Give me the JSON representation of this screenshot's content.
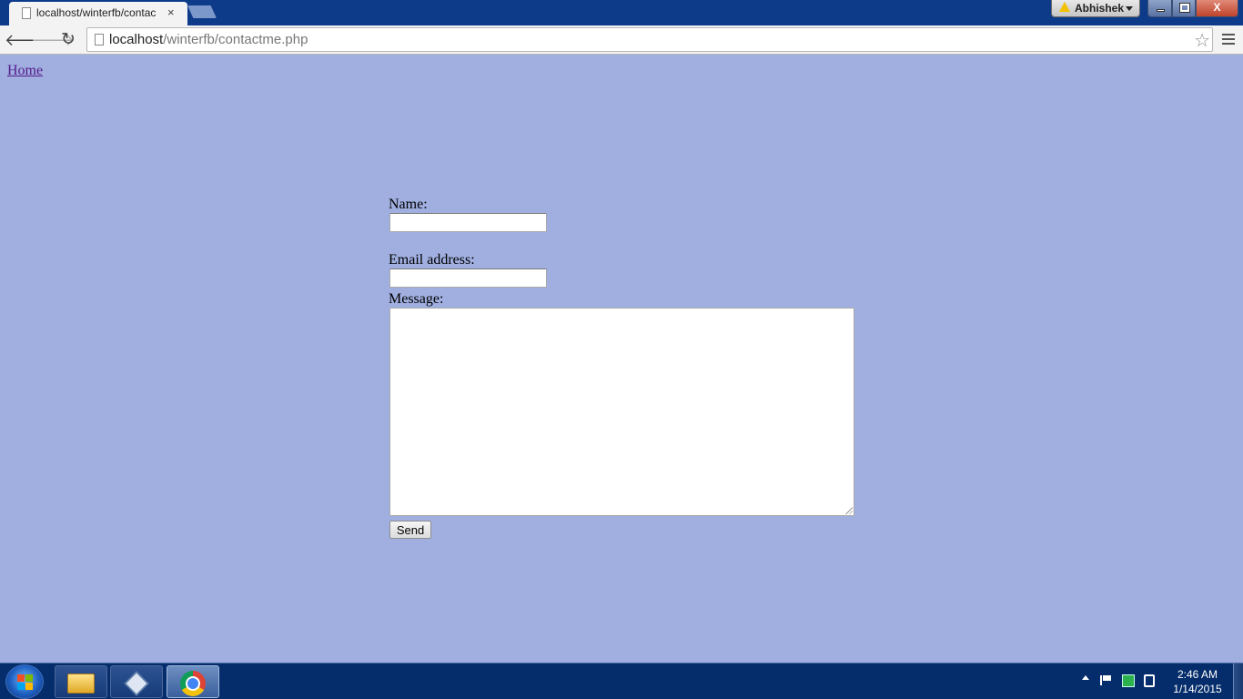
{
  "browser": {
    "tab_title": "localhost/winterfb/contac",
    "tab_close": "×",
    "profile_name": "Abhishek",
    "url_host": "localhost",
    "url_path": "/winterfb/contactme.php",
    "close_glyph": "X"
  },
  "page": {
    "home_link": "Home",
    "name_label": "Name:",
    "name_value": "",
    "email_label": "Email address:",
    "email_value": "",
    "message_label": "Message:",
    "message_value": "",
    "send_button": "Send",
    "background_color": "#a0afe0",
    "link_color": "#551a8b"
  },
  "taskbar": {
    "items": [
      "windows-explorer",
      "virtualbox",
      "google-chrome"
    ],
    "clock_time": "2:46 AM",
    "clock_date": "1/14/2015"
  }
}
